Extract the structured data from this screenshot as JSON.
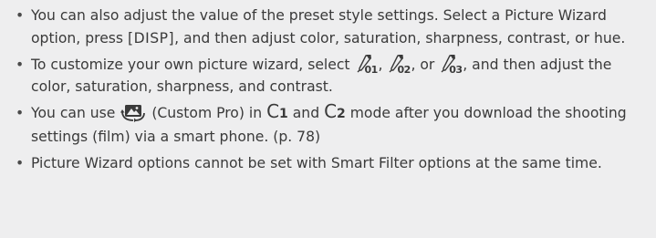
{
  "notes": {
    "item1": {
      "text_a": "You can also adjust the value of the preset style settings. Select a Picture Wizard option, press ",
      "key": "[DISP]",
      "text_b": ", and then adjust color, saturation, sharpness, contrast, or hue."
    },
    "item2": {
      "text_a": "To customize your own picture wizard, select ",
      "icon_1": "01",
      "sep_1": ", ",
      "icon_2": "02",
      "sep_2": ", or ",
      "icon_3": "03",
      "text_b": ", and then adjust the color, saturation, sharpness, and contrast."
    },
    "item3": {
      "text_a": "You can use ",
      "text_b": " (Custom Pro) in ",
      "mode_1": "C",
      "mode_1_sub": "1",
      "text_c": " and ",
      "mode_2": "C",
      "mode_2_sub": "2",
      "text_d": " mode after you download the shooting settings (film) via a smart phone. (p. 78)"
    },
    "item4": {
      "text": "Picture Wizard options cannot be set with Smart Filter options at the same time."
    }
  },
  "icons": {
    "wizard": "eyedropper-icon",
    "custom_pro": "custom-pro-icon"
  },
  "colors": {
    "background": "#eeeeef",
    "text": "#3a3a3a"
  }
}
